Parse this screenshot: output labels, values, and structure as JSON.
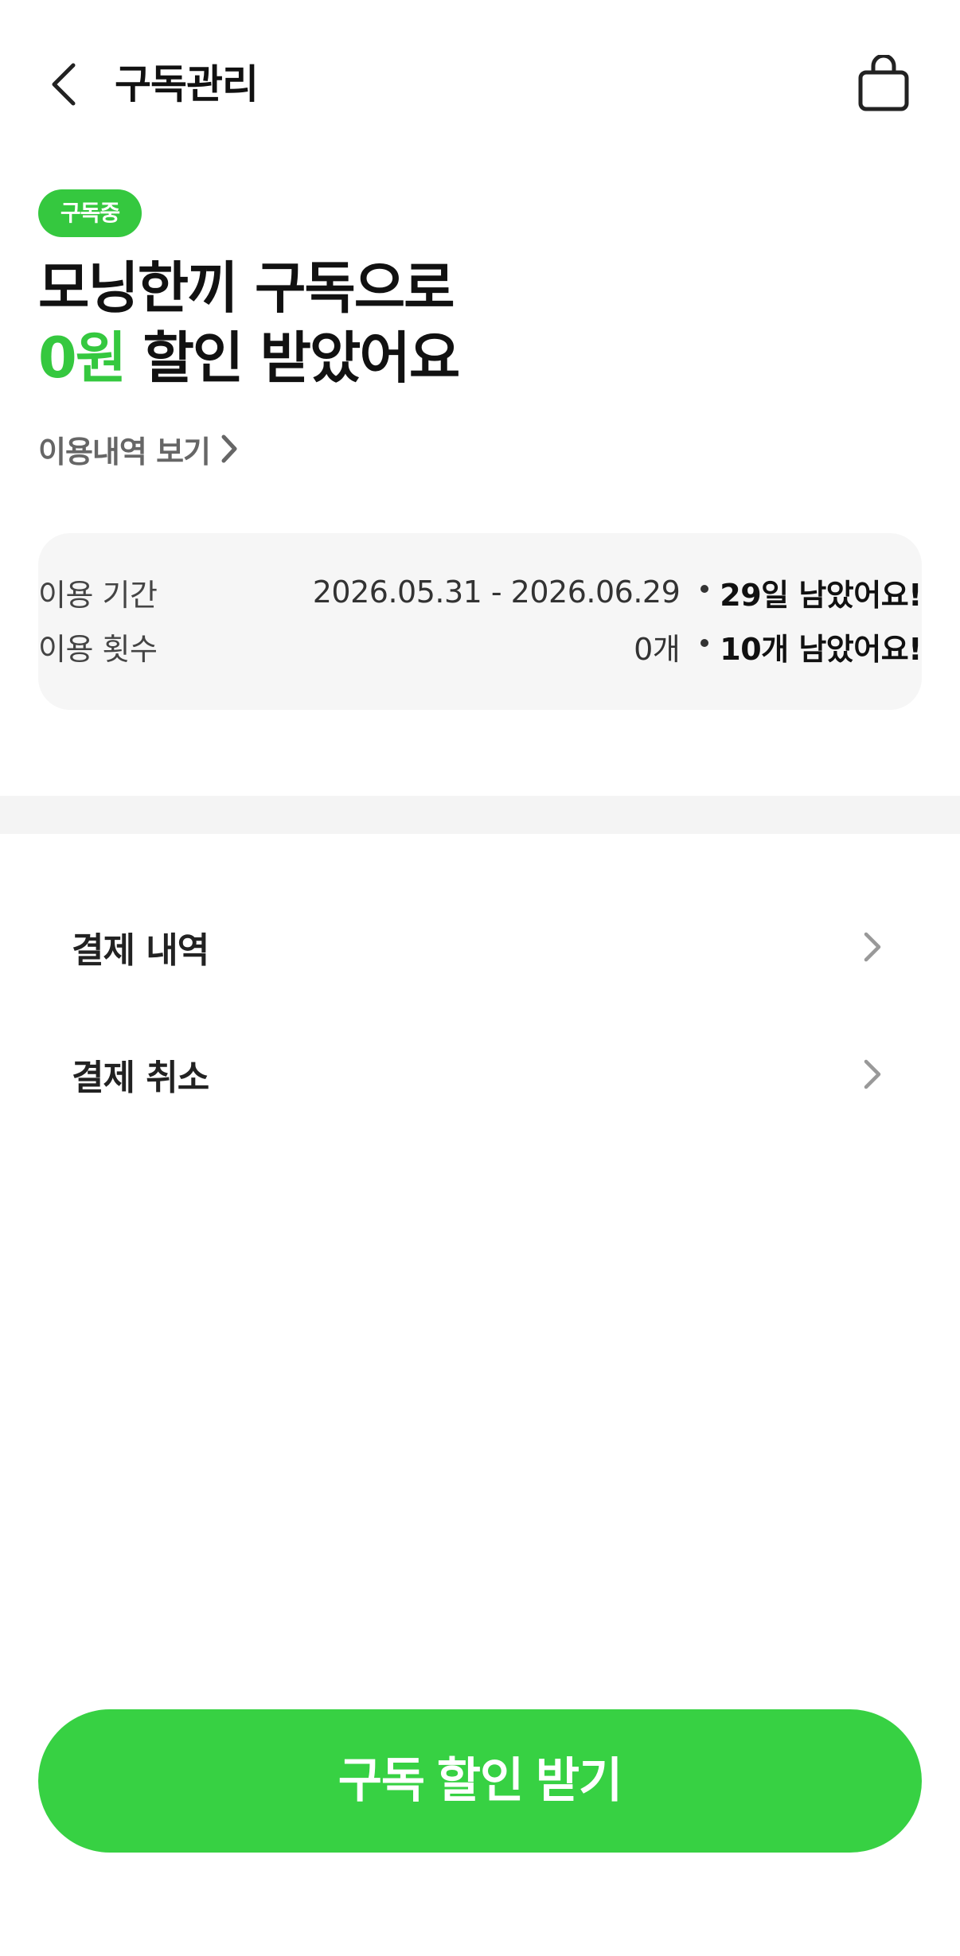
{
  "header": {
    "title": "구독관리",
    "back_icon": "chevron-left-icon",
    "cart_icon": "shopping-bag-icon"
  },
  "status": {
    "badge": "구독중"
  },
  "headline": {
    "line1": "모닝한끼 구독으로",
    "amount": "0원",
    "line2_rest": " 할인 받았어요"
  },
  "history_link": {
    "label": "이용내역 보기"
  },
  "usage": {
    "period_label": "이용 기간",
    "period_value": "2026.05.31 - 2026.06.29",
    "period_remaining": "29일 남았어요!",
    "count_label": "이용 횟수",
    "count_value": "0개",
    "count_remaining": "10개 남았어요!"
  },
  "menu": {
    "items": [
      {
        "label": "결제 내역"
      },
      {
        "label": "결제 취소"
      }
    ]
  },
  "cta": {
    "label": "구독 할인 받기"
  },
  "colors": {
    "accent": "#35c83f",
    "cta": "#37d143",
    "card_bg": "#f6f6f6"
  }
}
